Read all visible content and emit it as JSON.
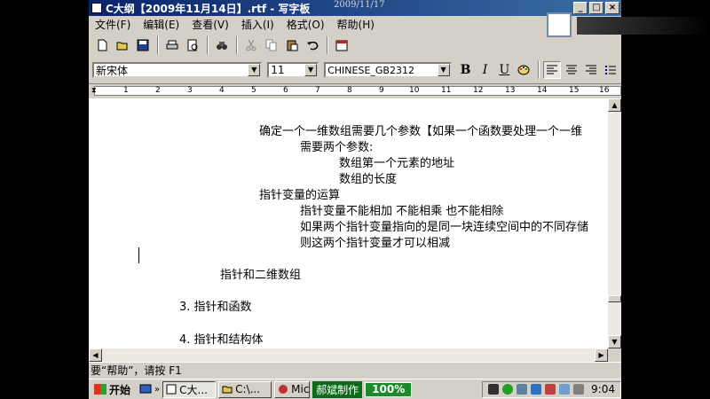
{
  "window": {
    "title": "C大纲【2009年11月14日】.rtf - 写字板",
    "date_stamp": "2009/11/17",
    "minimize": "_",
    "maximize": "□",
    "close": "×"
  },
  "menu": [
    "文件(F)",
    "编辑(E)",
    "查看(V)",
    "插入(I)",
    "格式(O)",
    "帮助(H)"
  ],
  "toolbar_icons": [
    "new-icon",
    "open-icon",
    "save-icon",
    "print-icon",
    "print-preview-icon",
    "find-icon",
    "cut-icon",
    "copy-icon",
    "paste-icon",
    "undo-icon",
    "insert-date-icon"
  ],
  "format": {
    "font_name": "新宋体",
    "font_size": "11",
    "script": "CHINESE_GB2312",
    "bold": "B",
    "italic": "I",
    "underline": "U"
  },
  "ruler": {
    "numbers": [
      "1",
      "2",
      "3",
      "4",
      "5",
      "6",
      "7",
      "8",
      "9",
      "10",
      "11",
      "12",
      "13",
      "14",
      "15",
      "16"
    ]
  },
  "document": {
    "lines": [
      "确定一个一维数组需要几个参数【如果一个函数要处理一个一维",
      "需要两个参数:",
      "数组第一个元素的地址",
      "数组的长度",
      "指针变量的运算",
      "指针变量不能相加 不能相乘 也不能相除",
      "如果两个指针变量指向的是同一块连续空间中的不同存储",
      "则这两个指针变量才可以相减",
      "指针和二维数组",
      "3.  指针和函数",
      "4.  指针和结构体"
    ]
  },
  "status": "要“帮助”，请按 F1",
  "taskbar": {
    "start_label": "开始",
    "tasks": [
      "C大...",
      "C:\\...",
      "Mic"
    ],
    "watermark": "郝斌制作",
    "zoom": "100%",
    "clock": "9:04"
  },
  "colors": {
    "titlebar": "#0a246a",
    "watermark_bg": "#0b6b1a"
  }
}
